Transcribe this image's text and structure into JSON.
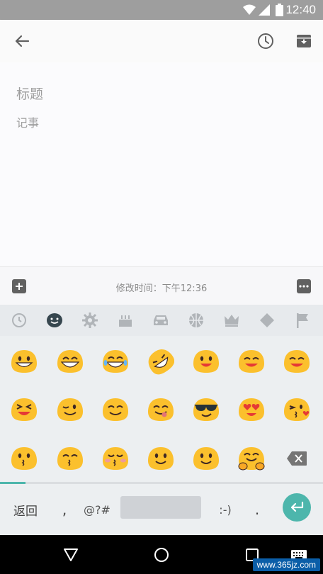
{
  "status_bar": {
    "time": "12:40"
  },
  "app_bar": {
    "back_icon": "arrow-left-icon",
    "reminder_icon": "clock-icon",
    "archive_icon": "archive-icon"
  },
  "editor": {
    "title_placeholder": "标题",
    "note_placeholder": "记事"
  },
  "bottom_bar": {
    "edited_label": "修改时间：下午12:36"
  },
  "emoji_categories": [
    "recent",
    "smileys",
    "objects",
    "celebration",
    "travel",
    "sports",
    "crown",
    "symbols",
    "flags"
  ],
  "keyboard": {
    "back_label": "返回",
    "comma": ",",
    "symbols_label": "@?#",
    "emoticon_label": ":-)",
    "period": "."
  },
  "watermark": "www.365jz.com",
  "colors": {
    "accent": "#4db6ac",
    "emoji_yellow": "#fbc02d",
    "status_bar": "#9e9e9e"
  }
}
